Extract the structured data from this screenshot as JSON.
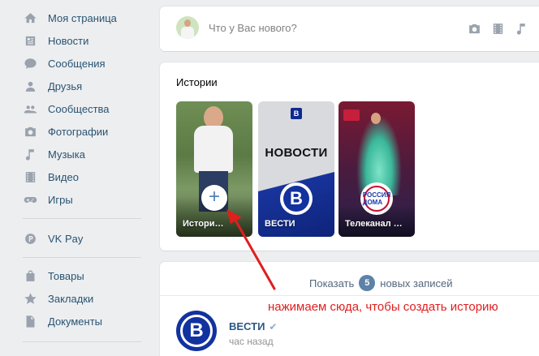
{
  "sidebar": {
    "items": [
      {
        "label": "Моя страница",
        "icon": "home-icon"
      },
      {
        "label": "Новости",
        "icon": "news-icon"
      },
      {
        "label": "Сообщения",
        "icon": "messages-icon"
      },
      {
        "label": "Друзья",
        "icon": "friends-icon"
      },
      {
        "label": "Сообщества",
        "icon": "communities-icon"
      },
      {
        "label": "Фотографии",
        "icon": "camera-icon"
      },
      {
        "label": "Музыка",
        "icon": "music-note-icon"
      },
      {
        "label": "Видео",
        "icon": "video-film-icon"
      },
      {
        "label": "Игры",
        "icon": "gamepad-icon"
      },
      {
        "label": "VK Pay",
        "icon": "vkpay-icon"
      },
      {
        "label": "Товары",
        "icon": "shopping-bag-icon"
      },
      {
        "label": "Закладки",
        "icon": "star-icon"
      },
      {
        "label": "Документы",
        "icon": "document-icon"
      }
    ]
  },
  "post_box": {
    "placeholder": "Что у Вас нового?",
    "tools": [
      "camera-icon",
      "video-film-icon",
      "music-note-icon",
      "text-format-icon"
    ]
  },
  "stories": {
    "title": "Истории",
    "items": [
      {
        "name": "Истори…",
        "kind": "my-story"
      },
      {
        "name": "ВЕСТИ",
        "headline": "НОВОСТИ",
        "logo": "В"
      },
      {
        "name": "Телеканал …",
        "logo": "РОССИЯ ДОМА"
      }
    ]
  },
  "feed": {
    "show_new_prefix": "Показать",
    "show_new_count": "5",
    "show_new_suffix": "новых записей",
    "post": {
      "author": "ВЕСТИ",
      "verified": "✔",
      "time": "час назад",
      "avatar_letter": "В"
    }
  },
  "annotation": {
    "text": "нажимаем сюда, чтобы создать историю",
    "color": "#e01e1e"
  },
  "colors": {
    "link": "#285473",
    "accent": "#5181b8",
    "background": "#edeef0"
  }
}
